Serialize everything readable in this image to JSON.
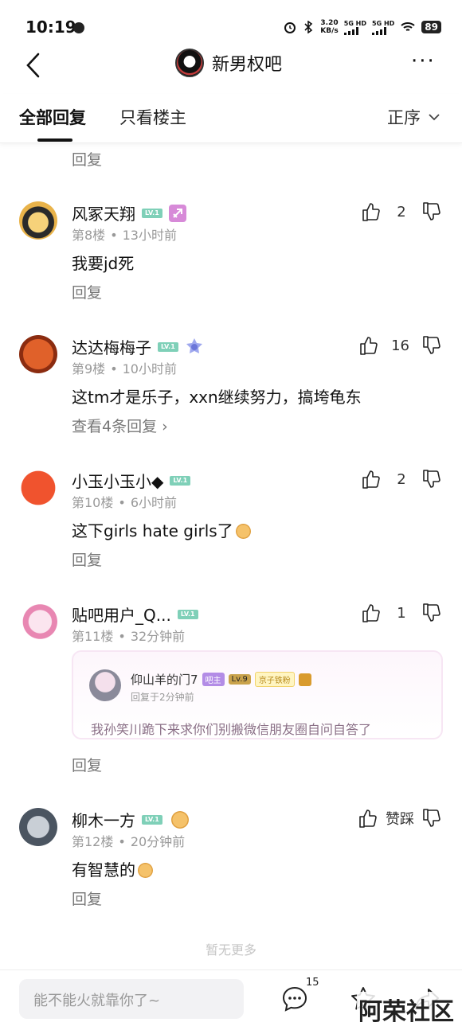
{
  "status_bar": {
    "time": "10:19",
    "speed_value": "3.20",
    "speed_unit": "KB/s",
    "net1": "5G HD",
    "net2": "5G HD",
    "battery": "89"
  },
  "nav": {
    "forum_name": "新男权吧",
    "more_label": "···"
  },
  "tabs": {
    "all_replies": "全部回复",
    "host_only": "只看楼主",
    "sort": "正序"
  },
  "top_reply_label": "回复",
  "comments": [
    {
      "name": "风冢天翔",
      "level": "LV.1",
      "floor": "第8楼",
      "time": "13小时前",
      "text": "我要jd死",
      "likes": "2",
      "footer": "回复"
    },
    {
      "name": "达达梅梅子",
      "level": "LV.1",
      "floor": "第9楼",
      "time": "10小时前",
      "text": "这tm才是乐子，xxn继续努力，搞垮龟东",
      "likes": "16",
      "footer": "查看4条回复 ›"
    },
    {
      "name": "小玉小玉小◆",
      "level": "LV.1",
      "floor": "第10楼",
      "time": "6小时前",
      "text": "这下girls hate girls了",
      "likes": "2",
      "footer": "回复"
    },
    {
      "name": "贴吧用户_Q...",
      "level": "LV.1",
      "floor": "第11楼",
      "time": "32分钟前",
      "likes": "1",
      "footer": "回复",
      "quote": {
        "name": "仰山羊的门7",
        "host_tag": "吧主",
        "level": "Lv.9",
        "fans_tag": "京子铁粉",
        "time": "回复于2分钟前",
        "text": "我孙笑川跪下来求你们别搬微信朋友圈自问自答了"
      }
    },
    {
      "name": "柳木一方",
      "level": "LV.1",
      "floor": "第12楼",
      "time": "20分钟前",
      "text": "有智慧的",
      "likes": "赞踩",
      "footer": "回复"
    }
  ],
  "no_more": "暂无更多",
  "bottom_bar": {
    "input_placeholder": "能不能火就靠你了~",
    "comment_count": "15"
  },
  "watermark": "阿荣社区",
  "colors": {
    "level_badge": "#7fd0b8",
    "meta_gray": "#999999",
    "quote_border": "#f7e6f4"
  }
}
